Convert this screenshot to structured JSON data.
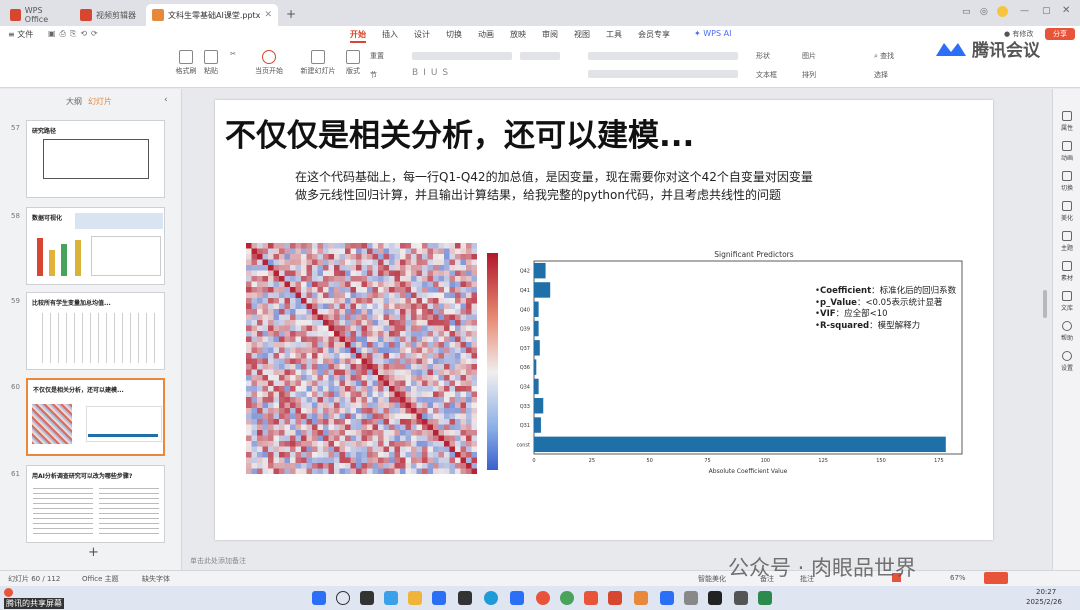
{
  "tabs": [
    {
      "label": "WPS Office",
      "color": "#d7462e"
    },
    {
      "label": "视频剪辑器",
      "color": "#d7462e"
    },
    {
      "label": "文科生零基础AI课堂.pptx",
      "color": "#e8883a"
    }
  ],
  "menu": {
    "file": "文件",
    "items": [
      "开始",
      "插入",
      "设计",
      "切换",
      "动画",
      "放映",
      "审阅",
      "视图",
      "工具",
      "会员专享"
    ],
    "ai": "WPS AI",
    "active": "开始"
  },
  "ribbon": {
    "format_painter": "格式刷",
    "paste": "粘贴",
    "from_start": "当页开始",
    "new_slide": "新建幻灯片",
    "layout": "版式",
    "section": "节",
    "reset": "重置",
    "shape": "形状",
    "text_box": "文本框",
    "picture": "图片",
    "arrange": "排列",
    "find": "查找",
    "select": "选择",
    "brand": "腾讯会议"
  },
  "sidebar": {
    "tab_outline": "大纲",
    "tab_slides": "幻灯片",
    "slides": [
      {
        "num": "57",
        "title": "研究路径"
      },
      {
        "num": "58",
        "title": "数据可视化"
      },
      {
        "num": "59",
        "title": "比较所有学生变量加总均值..."
      },
      {
        "num": "60",
        "title": "不仅仅是相关分析，还可以建模..."
      },
      {
        "num": "61",
        "title": "用AI分析调查研究可以改为哪些步骤?"
      }
    ],
    "add": "+"
  },
  "slide": {
    "title": "不仅仅是相关分析，还可以建模...",
    "para1": "在这个代码基础上，每一行Q1-Q42的加总值，是因变量，现在需要你对这个42个自变量对因变量",
    "para2": "做多元线性回归计算，并且输出计算结果，给我完整的python代码，并且考虑共线性的问题",
    "legend": [
      {
        "key": "Coefficient",
        "text": "：标准化后的回归系数"
      },
      {
        "key": "p_Value",
        "text": "：<0.05表示统计显著"
      },
      {
        "key": "VIF",
        "text": "：应全部<10"
      },
      {
        "key": "R-squared",
        "text": "：模型解释力"
      }
    ]
  },
  "chart_data": {
    "type": "bar",
    "title": "Significant Predictors",
    "xlabel": "Absolute Coefficient Value",
    "ylabel": "",
    "orientation": "horizontal",
    "categories": [
      "const",
      "Q31",
      "Q33",
      "Q34",
      "Q36",
      "Q37",
      "Q39",
      "Q40",
      "Q41",
      "Q42"
    ],
    "values": [
      178,
      3,
      4,
      2,
      1,
      2.5,
      2,
      2,
      7,
      5
    ],
    "xlim": [
      0,
      185
    ],
    "xticks": [
      0,
      25,
      50,
      75,
      100,
      125,
      150,
      175
    ],
    "bar_color": "#1f6fa8"
  },
  "notes_placeholder": "单击此处添加备注",
  "statusbar": {
    "slide_counter": "幻灯片 60 / 112",
    "theme": "Office 主题",
    "missing_font": "缺失字体",
    "smart_beautify": "智能美化",
    "notes": "备注",
    "comment": "批注",
    "zoom": "67%"
  },
  "right_panel": [
    "属性",
    "动画",
    "切换",
    "美化",
    "主题",
    "素材",
    "文库",
    "帮助",
    "设置"
  ],
  "taskbar": {
    "time": "20:27",
    "date": "2025/2/26"
  },
  "watermark": "公众号 · 肉眼品世界",
  "share_label": "腾讯的共享屏幕"
}
